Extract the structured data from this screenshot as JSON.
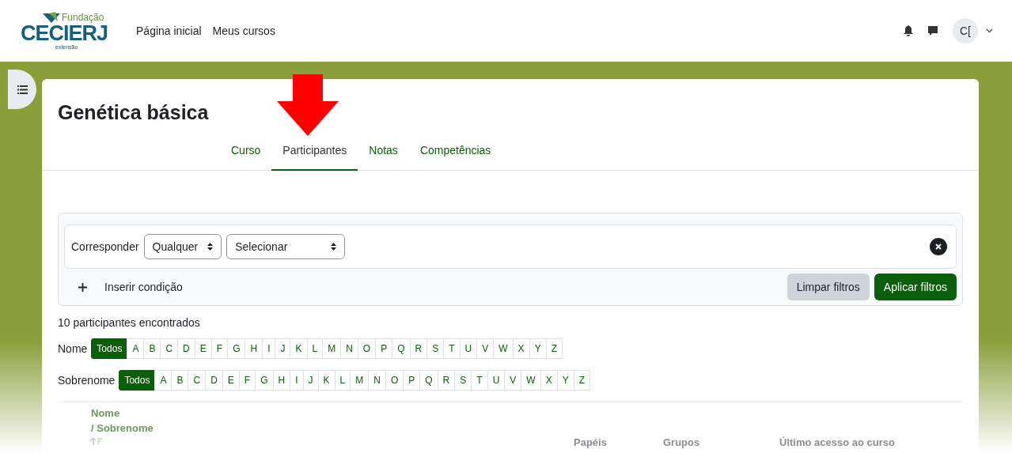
{
  "header": {
    "logo": {
      "top": "Fundação",
      "main": "CECIERJ",
      "bottom": "extensão"
    },
    "nav": [
      {
        "label": "Página inicial"
      },
      {
        "label": "Meus cursos"
      }
    ],
    "avatar": {
      "initials": "C["
    }
  },
  "course": {
    "title": "Genética básica",
    "tabs": [
      {
        "label": "Curso",
        "selected": false
      },
      {
        "label": "Participantes",
        "selected": true
      },
      {
        "label": "Notas",
        "selected": false
      },
      {
        "label": "Competências",
        "selected": false
      }
    ]
  },
  "filter": {
    "match_label": "Corresponder",
    "match_value": "Qualquer",
    "condition_value": "Selecionar",
    "add_condition": "Inserir condição",
    "clear_button": "Limpar filtros",
    "apply_button": "Aplicar filtros"
  },
  "result_count": "10 participantes encontrados",
  "initials_bars": [
    {
      "label": "Nome",
      "items": [
        {
          "text": "Todos",
          "selected": true
        },
        {
          "text": "A",
          "selected": false
        },
        {
          "text": "B",
          "selected": false
        },
        {
          "text": "C",
          "selected": false
        },
        {
          "text": "D",
          "selected": false
        },
        {
          "text": "E",
          "selected": false
        },
        {
          "text": "F",
          "selected": false
        },
        {
          "text": "G",
          "selected": false
        },
        {
          "text": "H",
          "selected": false
        },
        {
          "text": "I",
          "selected": false
        },
        {
          "text": "J",
          "selected": false
        },
        {
          "text": "K",
          "selected": false
        },
        {
          "text": "L",
          "selected": false
        },
        {
          "text": "M",
          "selected": false
        },
        {
          "text": "N",
          "selected": false
        },
        {
          "text": "O",
          "selected": false
        },
        {
          "text": "P",
          "selected": false
        },
        {
          "text": "Q",
          "selected": false
        },
        {
          "text": "R",
          "selected": false
        },
        {
          "text": "S",
          "selected": false
        },
        {
          "text": "T",
          "selected": false
        },
        {
          "text": "U",
          "selected": false
        },
        {
          "text": "V",
          "selected": false
        },
        {
          "text": "W",
          "selected": false
        },
        {
          "text": "X",
          "selected": false
        },
        {
          "text": "Y",
          "selected": false
        },
        {
          "text": "Z",
          "selected": false
        }
      ]
    },
    {
      "label": "Sobrenome",
      "items": [
        {
          "text": "Todos",
          "selected": true
        },
        {
          "text": "A",
          "selected": false
        },
        {
          "text": "B",
          "selected": false
        },
        {
          "text": "C",
          "selected": false
        },
        {
          "text": "D",
          "selected": false
        },
        {
          "text": "E",
          "selected": false
        },
        {
          "text": "F",
          "selected": false
        },
        {
          "text": "G",
          "selected": false
        },
        {
          "text": "H",
          "selected": false
        },
        {
          "text": "I",
          "selected": false
        },
        {
          "text": "J",
          "selected": false
        },
        {
          "text": "K",
          "selected": false
        },
        {
          "text": "L",
          "selected": false
        },
        {
          "text": "M",
          "selected": false
        },
        {
          "text": "N",
          "selected": false
        },
        {
          "text": "O",
          "selected": false
        },
        {
          "text": "P",
          "selected": false
        },
        {
          "text": "Q",
          "selected": false
        },
        {
          "text": "R",
          "selected": false
        },
        {
          "text": "S",
          "selected": false
        },
        {
          "text": "T",
          "selected": false
        },
        {
          "text": "U",
          "selected": false
        },
        {
          "text": "V",
          "selected": false
        },
        {
          "text": "W",
          "selected": false
        },
        {
          "text": "X",
          "selected": false
        },
        {
          "text": "Y",
          "selected": false
        },
        {
          "text": "Z",
          "selected": false
        }
      ]
    }
  ],
  "table": {
    "columns": [
      {
        "kind": "sortable",
        "parts": [
          "Nome",
          "/ Sobrenome"
        ]
      },
      {
        "kind": "plain",
        "label": "Papéis"
      },
      {
        "kind": "plain",
        "label": "Grupos"
      },
      {
        "kind": "plain",
        "label": "Último acesso ao curso"
      }
    ]
  }
}
